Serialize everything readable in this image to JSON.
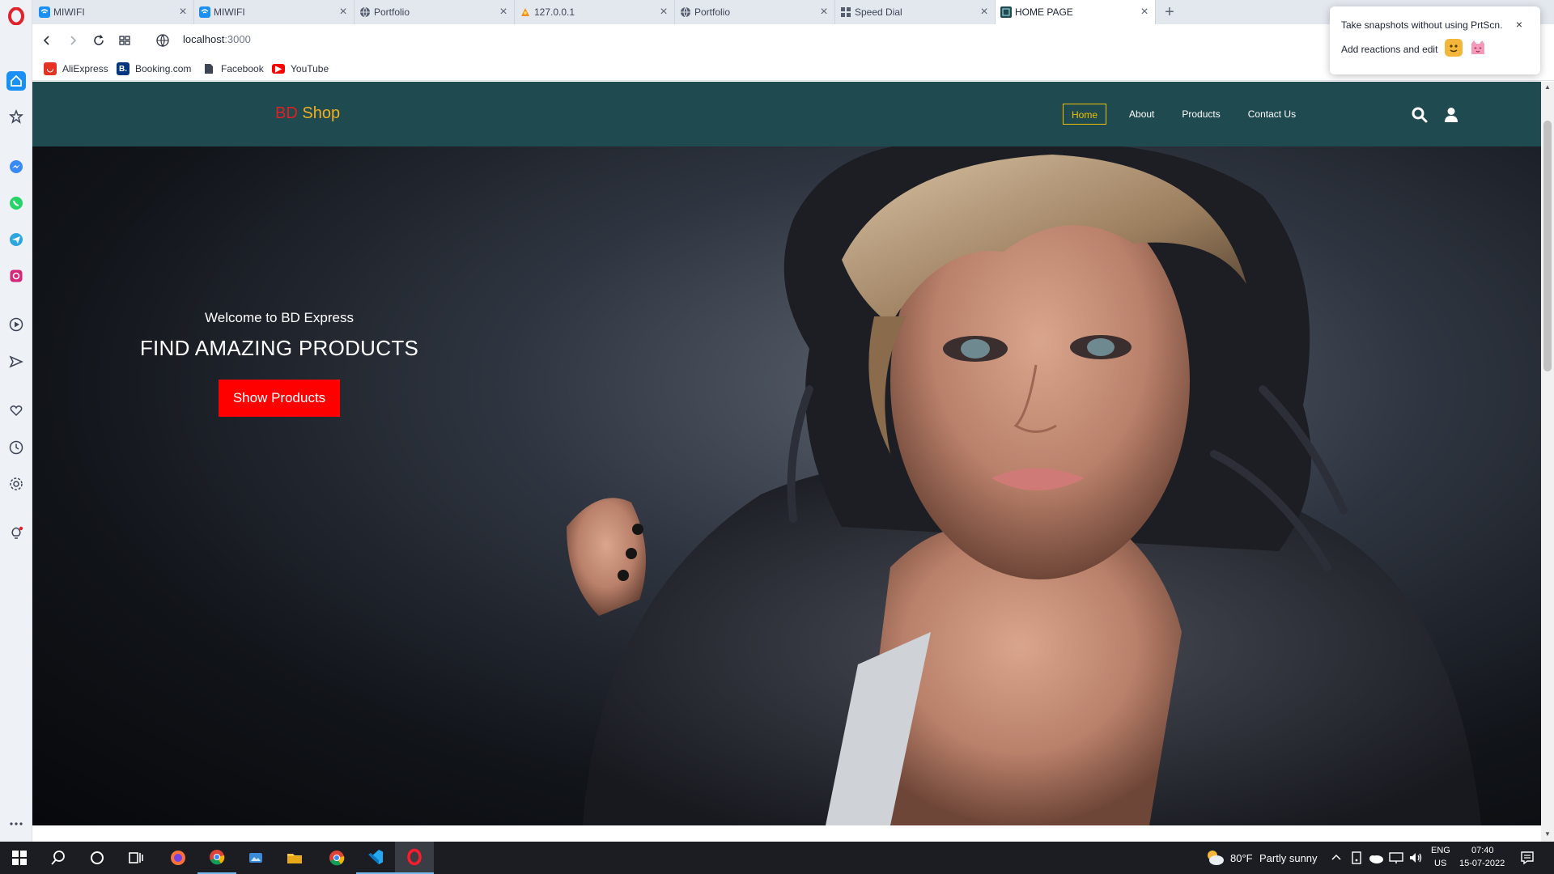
{
  "browser": {
    "tabs": [
      {
        "label": "MIWIFI",
        "favicon": "wifi-icon",
        "active": false
      },
      {
        "label": "MIWIFI",
        "favicon": "wifi-icon",
        "active": false
      },
      {
        "label": "Portfolio",
        "favicon": "globe-icon",
        "active": false
      },
      {
        "label": "127.0.0.1",
        "favicon": "xampp-icon",
        "active": false
      },
      {
        "label": "Portfolio",
        "favicon": "globe-icon",
        "active": false
      },
      {
        "label": "Speed Dial",
        "favicon": "grid-icon",
        "active": false
      },
      {
        "label": "HOME PAGE",
        "favicon": "page-icon",
        "active": true
      }
    ],
    "new_tab_label": "+",
    "address": {
      "host": "localhost",
      "port": ":3000"
    },
    "bookmarks": [
      {
        "label": "AliExpress",
        "icon": "aliexpress-icon",
        "color": "#e43225"
      },
      {
        "label": "Booking.com",
        "icon": "booking-icon",
        "color": "#003580"
      },
      {
        "label": "Facebook",
        "icon": "document-icon",
        "color": "#3d4454"
      },
      {
        "label": "YouTube",
        "icon": "youtube-icon",
        "color": "#ff0000"
      }
    ],
    "toast": {
      "line1": "Take snapshots without using PrtScn.",
      "line2": "Add reactions and edit",
      "close": "×"
    }
  },
  "site": {
    "brand": {
      "part1": "BD",
      "part2": " Shop"
    },
    "nav": [
      {
        "label": "Home",
        "active": true
      },
      {
        "label": "About",
        "active": false
      },
      {
        "label": "Products",
        "active": false
      },
      {
        "label": "Contact Us",
        "active": false
      }
    ],
    "hero": {
      "welcome": "Welcome to BD Express",
      "title": "FIND AMAZING PRODUCTS",
      "button": "Show Products"
    },
    "colors": {
      "header_bg": "#1f4a50",
      "brand_red": "#e02020",
      "brand_yellow": "#f0b020",
      "cta": "#ff0000",
      "nav_active": "#f0c000"
    }
  },
  "taskbar": {
    "weather": {
      "temp": "80°F",
      "condition": "Partly sunny"
    },
    "language": {
      "lang": "ENG",
      "region": "US"
    },
    "clock": {
      "time": "07:40",
      "date": "15-07-2022"
    }
  }
}
